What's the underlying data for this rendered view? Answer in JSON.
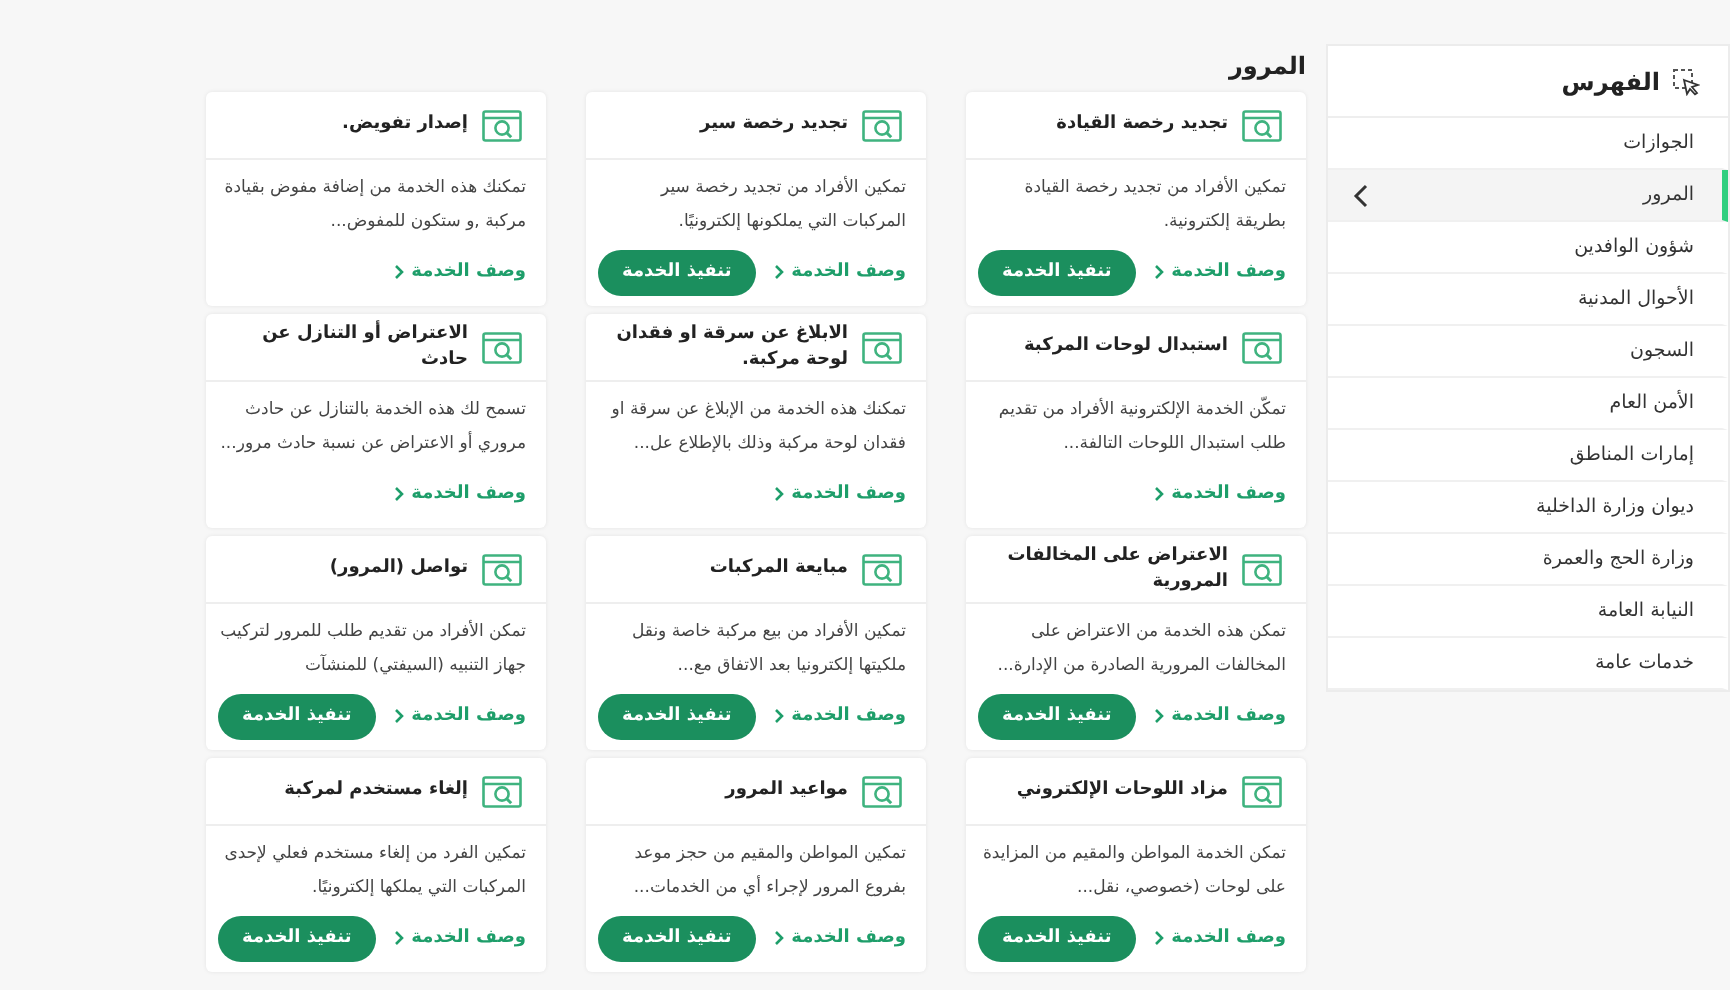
{
  "sidebar": {
    "title": "الفهرس",
    "items": [
      {
        "label": "الجوازات",
        "selected": false
      },
      {
        "label": "المرور",
        "selected": true
      },
      {
        "label": "شؤون الوافدين",
        "selected": false
      },
      {
        "label": "الأحوال المدنية",
        "selected": false
      },
      {
        "label": "السجون",
        "selected": false
      },
      {
        "label": "الأمن العام",
        "selected": false
      },
      {
        "label": "إمارات المناطق",
        "selected": false
      },
      {
        "label": "ديوان وزارة الداخلية",
        "selected": false
      },
      {
        "label": "وزارة الحج والعمرة",
        "selected": false
      },
      {
        "label": "النيابة العامة",
        "selected": false
      },
      {
        "label": "خدمات عامة",
        "selected": false
      }
    ]
  },
  "heading": "المرور",
  "services": [
    {
      "title": "تجديد رخصة القيادة",
      "description": "تمكين الأفراد من تجديد رخصة القيادة بطريقة إلكترونية.",
      "link": "وصف الخدمة",
      "button": "تنفيذ الخدمة"
    },
    {
      "title": "تجديد رخصة سير",
      "description": "تمكين الأفراد من تجديد رخصة سير المركبات التي يملكونها إلكترونيًا.",
      "link": "وصف الخدمة",
      "button": "تنفيذ الخدمة"
    },
    {
      "title": "إصدار تفويض.",
      "description": "تمكنك هذه الخدمة من إضافة مفوض بقيادة مركبة ,و ستكون للمفوض...",
      "link": "وصف الخدمة"
    },
    {
      "title": "استبدال لوحات المركبة",
      "description": "تمكّن الخدمة الإلكترونية الأفراد من تقديم طلب استبدال اللوحات التالفة...",
      "link": "وصف الخدمة"
    },
    {
      "title": "الابلاغ عن سرقة او فقدان لوحة مركبة.",
      "description": "تمكنك هذه الخدمة من الإبلاغ عن سرقة او فقدان لوحة مركبة وذلك بالإطلاع عل...",
      "link": "وصف الخدمة"
    },
    {
      "title": "الاعتراض أو التنازل عن حادث",
      "description": "تسمح لك هذه الخدمة بالتنازل عن حادث مروري أو الاعتراض عن نسبة حادث مرور...",
      "link": "وصف الخدمة"
    },
    {
      "title": "الاعتراض على المخالفات المرورية",
      "description": "تمكن هذه الخدمة من الاعتراض على المخالفات المرورية الصادرة من الإدارة...",
      "link": "وصف الخدمة",
      "button": "تنفيذ الخدمة"
    },
    {
      "title": "مبايعة المركبات",
      "description": "تمكين الأفراد من بيع مركبة خاصة ونقل ملكيتها إلكترونيا بعد الاتفاق مع...",
      "link": "وصف الخدمة",
      "button": "تنفيذ الخدمة"
    },
    {
      "title": "تواصل (المرور)",
      "description": "تمكن الأفراد من تقديم طلب للمرور لتركيب جهاز التنبيه (السيفتي) للمنشآت",
      "link": "وصف الخدمة",
      "button": "تنفيذ الخدمة"
    },
    {
      "title": "مزاد اللوحات الإلكتروني",
      "description": "تمكن الخدمة المواطن والمقيم من المزايدة على لوحات (خصوصي، نقل...",
      "link": "وصف الخدمة",
      "button": "تنفيذ الخدمة"
    },
    {
      "title": "مواعيد المرور",
      "description": "تمكين المواطن والمقيم من حجز موعد بفروع المرور لإجراء أي من الخدمات...",
      "link": "وصف الخدمة",
      "button": "تنفيذ الخدمة"
    },
    {
      "title": "إلغاء مستخدم لمركبة",
      "description": "تمكين الفرد من إلغاء مستخدم فعلي لإحدى المركبات التي يملكها إلكترونيًا.",
      "link": "وصف الخدمة",
      "button": "تنفيذ الخدمة"
    }
  ]
}
